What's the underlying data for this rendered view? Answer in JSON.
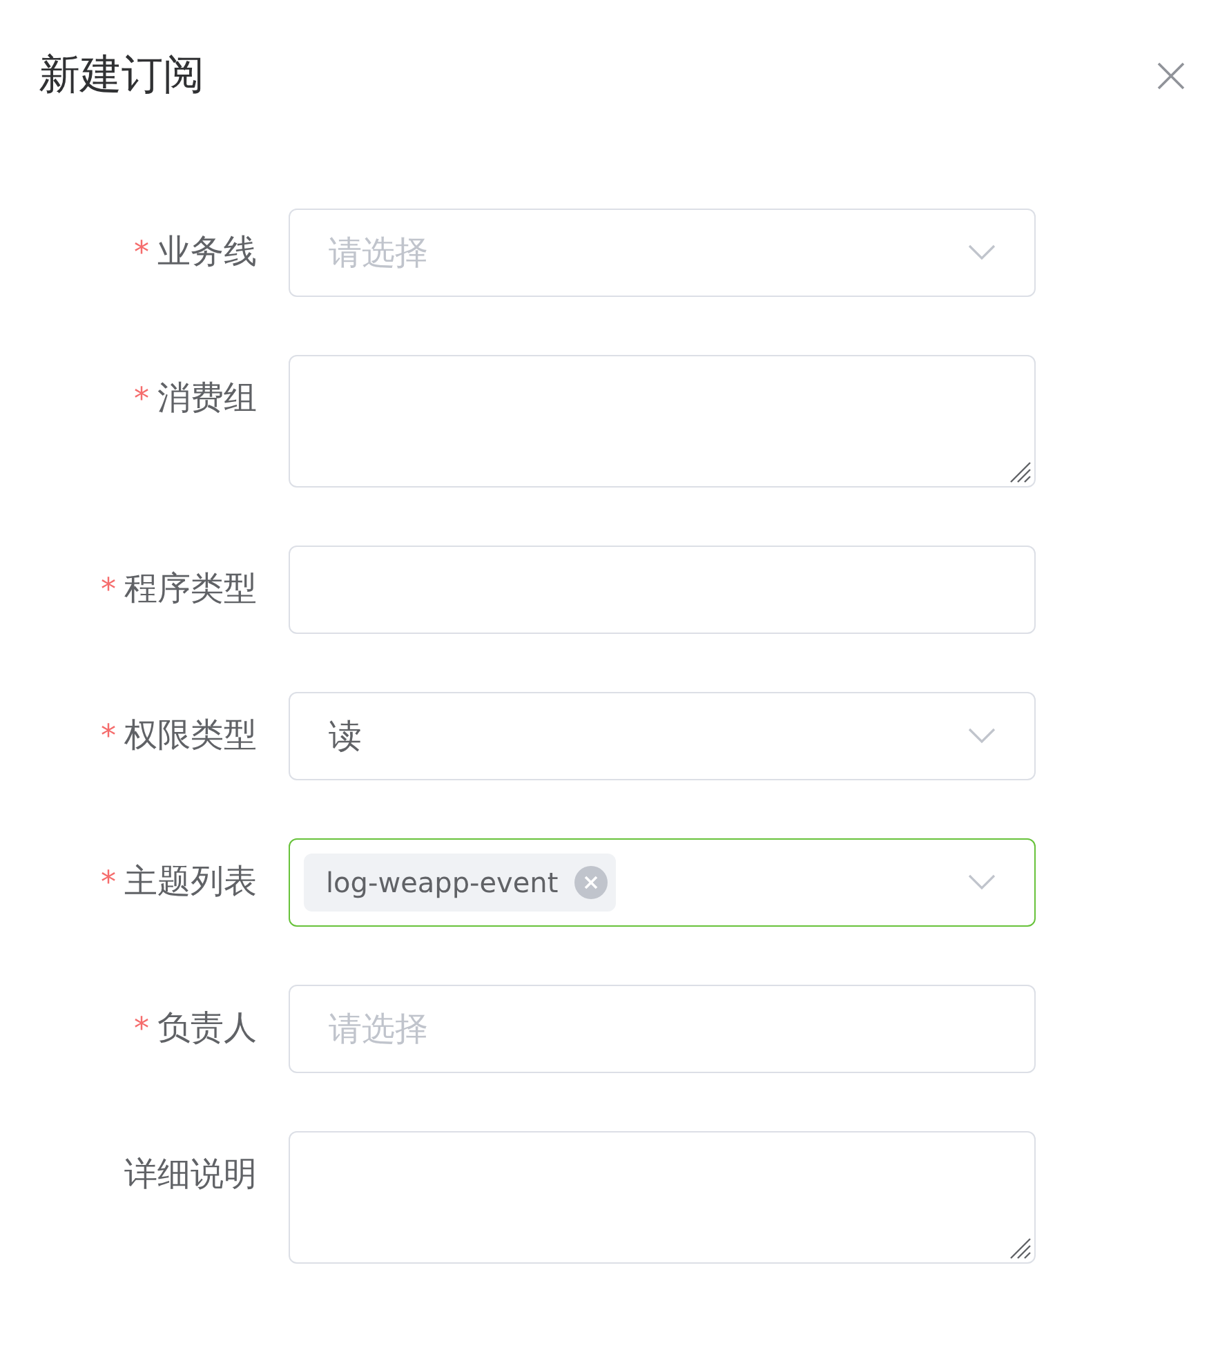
{
  "dialog": {
    "title": "新建订阅"
  },
  "fields": [
    {
      "label": "业务线",
      "required_mark": "*",
      "kind": "select",
      "placeholder": "请选择",
      "focused": false
    },
    {
      "label": "消费组",
      "required_mark": "*",
      "kind": "textarea",
      "focused": false
    },
    {
      "label": "程序类型",
      "required_mark": "*",
      "kind": "input",
      "focused": false
    },
    {
      "label": "权限类型",
      "required_mark": "*",
      "kind": "select",
      "value": "读",
      "focused": false
    },
    {
      "label": "主题列表",
      "required_mark": "*",
      "kind": "select",
      "tags": [
        {
          "label": "log-weapp-event"
        }
      ],
      "focused": true
    },
    {
      "label": "负责人",
      "required_mark": "*",
      "kind": "input",
      "placeholder": "请选择",
      "focused": false
    },
    {
      "label": "详细说明",
      "kind": "textarea",
      "focused": false
    }
  ]
}
